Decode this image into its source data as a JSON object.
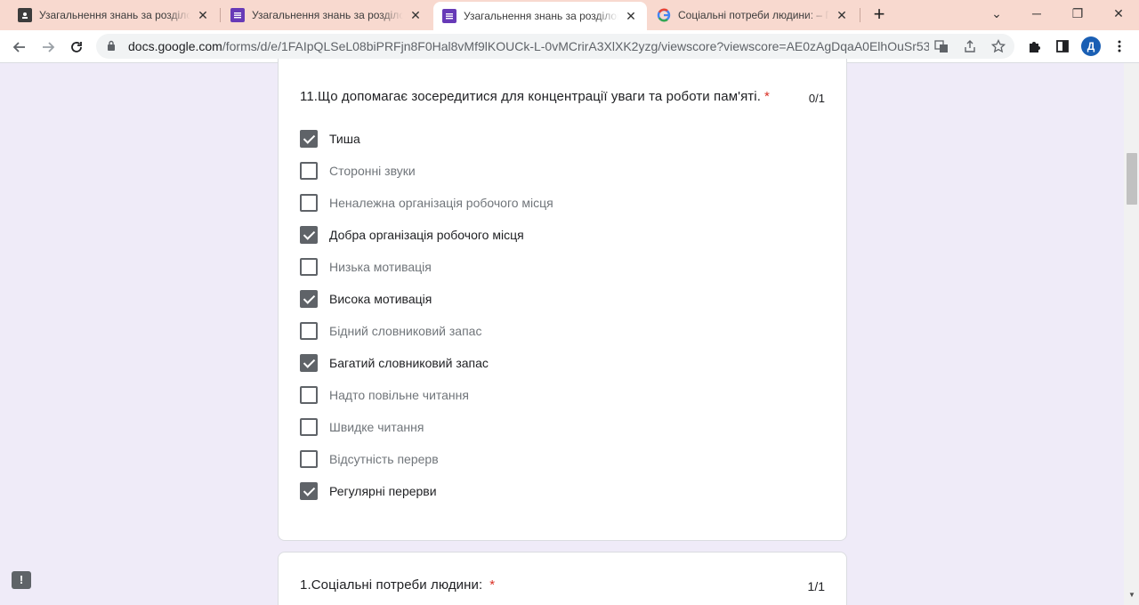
{
  "tabs": [
    {
      "title": "Узагальнення знань за розділом",
      "icon": "classroom-icon",
      "close": "✕"
    },
    {
      "title": "Узагальнення знань за розділом",
      "icon": "forms-icon",
      "close": "✕"
    },
    {
      "title": "Узагальнення знань за розділом",
      "icon": "forms-icon",
      "close": "✕"
    },
    {
      "title": "Соціальні потреби людини: – П",
      "icon": "google-icon",
      "close": "✕"
    }
  ],
  "window": {
    "newtab": "+",
    "minimize": "─",
    "restore": "❐",
    "close": "✕",
    "tab_search": "⌄"
  },
  "toolbar": {
    "url_domain": "docs.google.com",
    "url_rest": "/forms/d/e/1FAIpQLSeL08biPRFjn8F0Hal8vMf9lKOUCk-L-0vMCrirA3XlXK2yzg/viewscore?viewscore=AE0zAgDqaA0ElhOuSr53w...",
    "profile_initial": "Д"
  },
  "question11": {
    "title": "11.Що допомагає зосередитися для концентрації уваги та роботи пам'яті.",
    "required_mark": "*",
    "score": "0/1",
    "options": [
      {
        "label": "Тиша",
        "checked": true
      },
      {
        "label": "Сторонні звуки",
        "checked": false
      },
      {
        "label": "Неналежна організація робочого місця",
        "checked": false
      },
      {
        "label": "Добра організація робочого місця",
        "checked": true
      },
      {
        "label": "Низька мотивація",
        "checked": false
      },
      {
        "label": "Висока мотивація",
        "checked": true
      },
      {
        "label": "Бідний словниковий запас",
        "checked": false
      },
      {
        "label": "Багатий словниковий запас",
        "checked": true
      },
      {
        "label": "Надто повільне читання",
        "checked": false
      },
      {
        "label": "Швидке читання",
        "checked": false
      },
      {
        "label": "Відсутність перерв",
        "checked": false
      },
      {
        "label": "Регулярні перерви",
        "checked": true
      }
    ]
  },
  "question1": {
    "title": "1.Соціальні потреби людини:",
    "required_mark": "*",
    "score": "1/1"
  },
  "feedback": {
    "label": "!"
  }
}
